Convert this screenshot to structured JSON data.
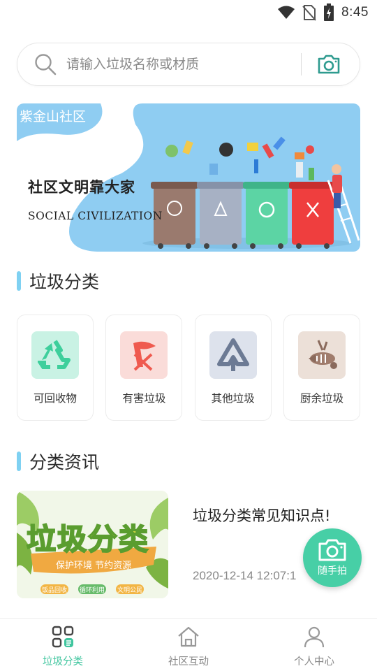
{
  "status_bar": {
    "time": "8:45",
    "icons": [
      "wifi-icon",
      "no-sim-icon",
      "battery-icon"
    ]
  },
  "search": {
    "placeholder": "请输入垃圾名称或材质",
    "value": "",
    "icons": [
      "search-icon",
      "camera-icon"
    ]
  },
  "banner": {
    "tag": "紫金山社区",
    "headline": "社区文明靠大家",
    "subline": "SOCIAL CIVILIZATION"
  },
  "sections": {
    "categories_title": "垃圾分类",
    "news_title": "分类资讯"
  },
  "categories": [
    {
      "label": "可回收物",
      "icon": "recycle-icon",
      "bg": "#c9f2e4",
      "color": "#3ecf9c"
    },
    {
      "label": "有害垃圾",
      "icon": "hazardous-icon",
      "bg": "#fadcd9",
      "color": "#ef5a4f"
    },
    {
      "label": "其他垃圾",
      "icon": "other-waste-icon",
      "bg": "#dde2ec",
      "color": "#6c7a94"
    },
    {
      "label": "厨余垃圾",
      "icon": "kitchen-waste-icon",
      "bg": "#ece0d8",
      "color": "#8a6a5c"
    }
  ],
  "news": [
    {
      "title": "垃圾分类常见知识点!",
      "date": "2020-12-14 12:07:1",
      "thumb": {
        "headline": "垃圾分类",
        "ribbon": "保护环境 节约资源",
        "badges": [
          "饭品回收",
          "循环利用",
          "文明公民"
        ]
      }
    }
  ],
  "fab": {
    "label": "随手拍",
    "icon": "camera-icon"
  },
  "bottom_nav": [
    {
      "label": "垃圾分类",
      "icon": "category-icon",
      "active": true
    },
    {
      "label": "社区互动",
      "icon": "home-icon",
      "active": false
    },
    {
      "label": "个人中心",
      "icon": "user-icon",
      "active": false
    }
  ],
  "colors": {
    "accent": "#3fc59e",
    "section_bar": "#7fd1f2",
    "banner_sky": "#8fcdf2"
  }
}
